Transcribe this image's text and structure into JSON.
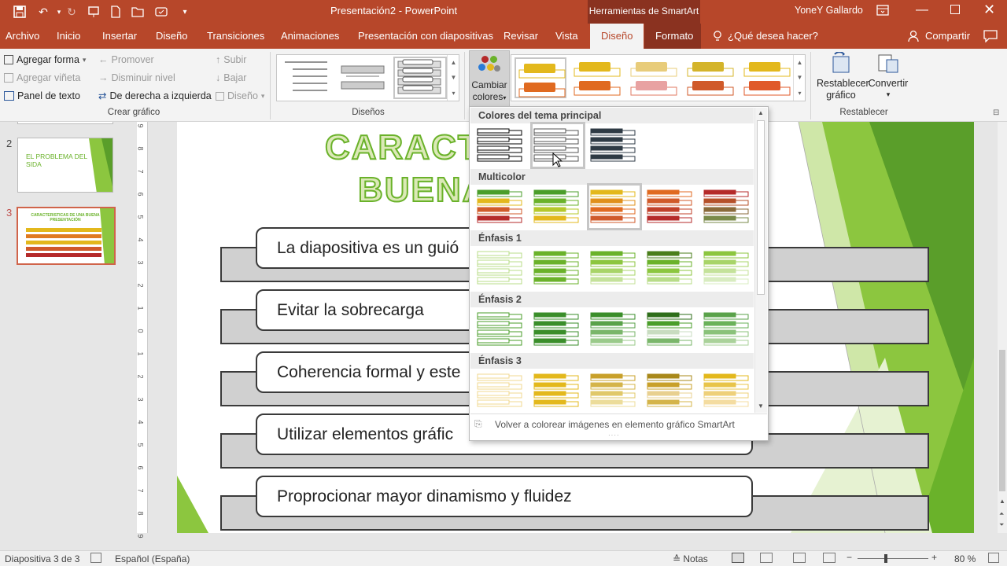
{
  "titlebar": {
    "doc_title": "Presentación2  -  PowerPoint",
    "context_title": "Herramientas de SmartArt",
    "user": "YoneY Gallardo"
  },
  "tabs": [
    {
      "label": "Archivo"
    },
    {
      "label": "Inicio"
    },
    {
      "label": "Insertar"
    },
    {
      "label": "Diseño"
    },
    {
      "label": "Transiciones"
    },
    {
      "label": "Animaciones"
    },
    {
      "label": "Presentación con diapositivas"
    },
    {
      "label": "Revisar"
    },
    {
      "label": "Vista"
    },
    {
      "label": "Diseño"
    },
    {
      "label": "Formato"
    }
  ],
  "tell_me": "¿Qué desea hacer?",
  "share": "Compartir",
  "ribbon": {
    "crear": {
      "agregar_forma": "Agregar forma",
      "agregar_vineta": "Agregar viñeta",
      "panel_texto": "Panel de texto",
      "promover": "Promover",
      "disminuir": "Disminuir nivel",
      "derecha_izquierda": "De derecha a izquierda",
      "subir": "Subir",
      "bajar": "Bajar",
      "diseno": "Diseño",
      "group_label": "Crear gráfico"
    },
    "disenos_label": "Diseños",
    "cambiar_colores_1": "Cambiar",
    "cambiar_colores_2": "colores",
    "restablecer_grafico_1": "Restablecer",
    "restablecer_grafico_2": "gráfico",
    "convertir": "Convertir",
    "restablecer_label": "Restablecer"
  },
  "slides": [
    {
      "number": "2",
      "title": "EL PROBLEMA DEL SIDA"
    },
    {
      "number": "3",
      "title": "CARACTERISTICAS DE UNA BUENA PRESENTACIÓN"
    }
  ],
  "slide": {
    "title_line1": "CARACTE",
    "title_line2": "BUENA",
    "items": [
      "La diapositiva es un guió",
      "Evitar la sobrecarga",
      "Coherencia formal y este",
      "Utilizar elementos gráfic",
      "Proprocionar mayor dinamismo y fluidez"
    ]
  },
  "dropdown": {
    "sections": [
      "Colores del tema principal",
      "Multicolor",
      "Énfasis 1",
      "Énfasis 2",
      "Énfasis 3"
    ],
    "footer": "Volver a colorear imágenes en elemento gráfico SmartArt"
  },
  "status": {
    "slide_count": "Diapositiva 3 de 3",
    "language": "Español (España)",
    "notes": "Notas",
    "zoom": "80 %"
  },
  "colors": {
    "accent": "#b7472a",
    "green": "#6ab22a",
    "yellow": "#e3b81c",
    "orange": "#e06a20",
    "red": "#b52a2a"
  }
}
